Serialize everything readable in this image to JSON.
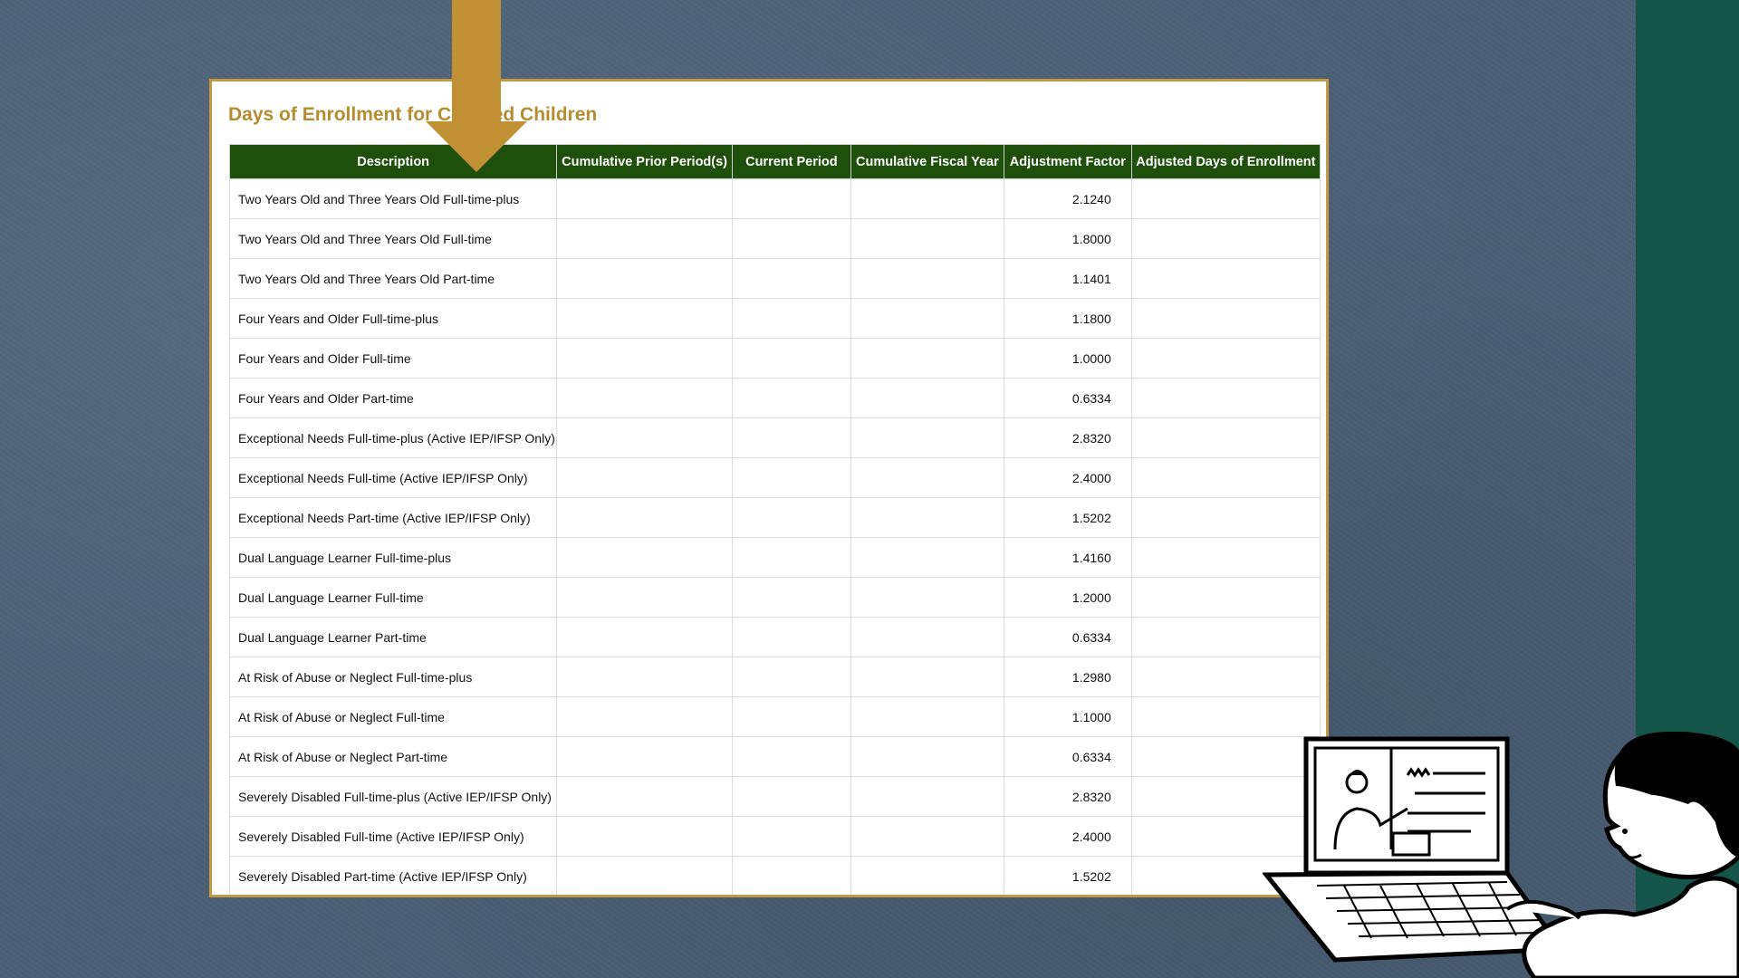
{
  "document": {
    "title": "Days of Enrollment for Certified Children"
  },
  "table": {
    "headers": [
      "Description",
      "Cumulative Prior Period(s)",
      "Current Period",
      "Cumulative Fiscal Year",
      "Adjustment Factor",
      "Adjusted Days of Enrollment"
    ],
    "rows": [
      {
        "description": "Two Years Old and Three Years Old Full-time-plus",
        "prior": "",
        "current": "",
        "fiscal": "",
        "factor": "2.1240",
        "adjusted": ""
      },
      {
        "description": "Two Years Old and Three Years Old Full-time",
        "prior": "",
        "current": "",
        "fiscal": "",
        "factor": "1.8000",
        "adjusted": ""
      },
      {
        "description": "Two Years Old and Three Years Old Part-time",
        "prior": "",
        "current": "",
        "fiscal": "",
        "factor": "1.1401",
        "adjusted": ""
      },
      {
        "description": "Four Years and Older Full-time-plus",
        "prior": "",
        "current": "",
        "fiscal": "",
        "factor": "1.1800",
        "adjusted": ""
      },
      {
        "description": "Four Years and Older Full-time",
        "prior": "",
        "current": "",
        "fiscal": "",
        "factor": "1.0000",
        "adjusted": ""
      },
      {
        "description": "Four Years and Older Part-time",
        "prior": "",
        "current": "",
        "fiscal": "",
        "factor": "0.6334",
        "adjusted": ""
      },
      {
        "description": "Exceptional Needs Full-time-plus (Active IEP/IFSP Only)",
        "prior": "",
        "current": "",
        "fiscal": "",
        "factor": "2.8320",
        "adjusted": ""
      },
      {
        "description": "Exceptional Needs Full-time (Active IEP/IFSP Only)",
        "prior": "",
        "current": "",
        "fiscal": "",
        "factor": "2.4000",
        "adjusted": ""
      },
      {
        "description": "Exceptional Needs Part-time (Active IEP/IFSP Only)",
        "prior": "",
        "current": "",
        "fiscal": "",
        "factor": "1.5202",
        "adjusted": ""
      },
      {
        "description": "Dual Language Learner Full-time-plus",
        "prior": "",
        "current": "",
        "fiscal": "",
        "factor": "1.4160",
        "adjusted": ""
      },
      {
        "description": "Dual Language Learner Full-time",
        "prior": "",
        "current": "",
        "fiscal": "",
        "factor": "1.2000",
        "adjusted": ""
      },
      {
        "description": "Dual Language Learner Part-time",
        "prior": "",
        "current": "",
        "fiscal": "",
        "factor": "0.6334",
        "adjusted": ""
      },
      {
        "description": "At Risk of Abuse or Neglect Full-time-plus",
        "prior": "",
        "current": "",
        "fiscal": "",
        "factor": "1.2980",
        "adjusted": ""
      },
      {
        "description": "At Risk of Abuse or Neglect Full-time",
        "prior": "",
        "current": "",
        "fiscal": "",
        "factor": "1.1000",
        "adjusted": ""
      },
      {
        "description": "At Risk of Abuse or Neglect Part-time",
        "prior": "",
        "current": "",
        "fiscal": "",
        "factor": "0.6334",
        "adjusted": ""
      },
      {
        "description": "Severely Disabled Full-time-plus (Active IEP/IFSP Only)",
        "prior": "",
        "current": "",
        "fiscal": "",
        "factor": "2.8320",
        "adjusted": ""
      },
      {
        "description": "Severely Disabled Full-time (Active IEP/IFSP Only)",
        "prior": "",
        "current": "",
        "fiscal": "",
        "factor": "2.4000",
        "adjusted": ""
      },
      {
        "description": "Severely Disabled Part-time (Active IEP/IFSP Only)",
        "prior": "",
        "current": "",
        "fiscal": "",
        "factor": "1.5202",
        "adjusted": ""
      }
    ]
  },
  "colors": {
    "background": "#4b6075",
    "side_strip": "#155448",
    "header_fill": "#1e4f0b",
    "title_gold": "#b58c2e",
    "frame_border": "#c29a44",
    "arrow": "#c18f34"
  },
  "icons": {
    "arrow": "down-arrow-icon",
    "illustration": "person-at-laptop-illustration"
  }
}
